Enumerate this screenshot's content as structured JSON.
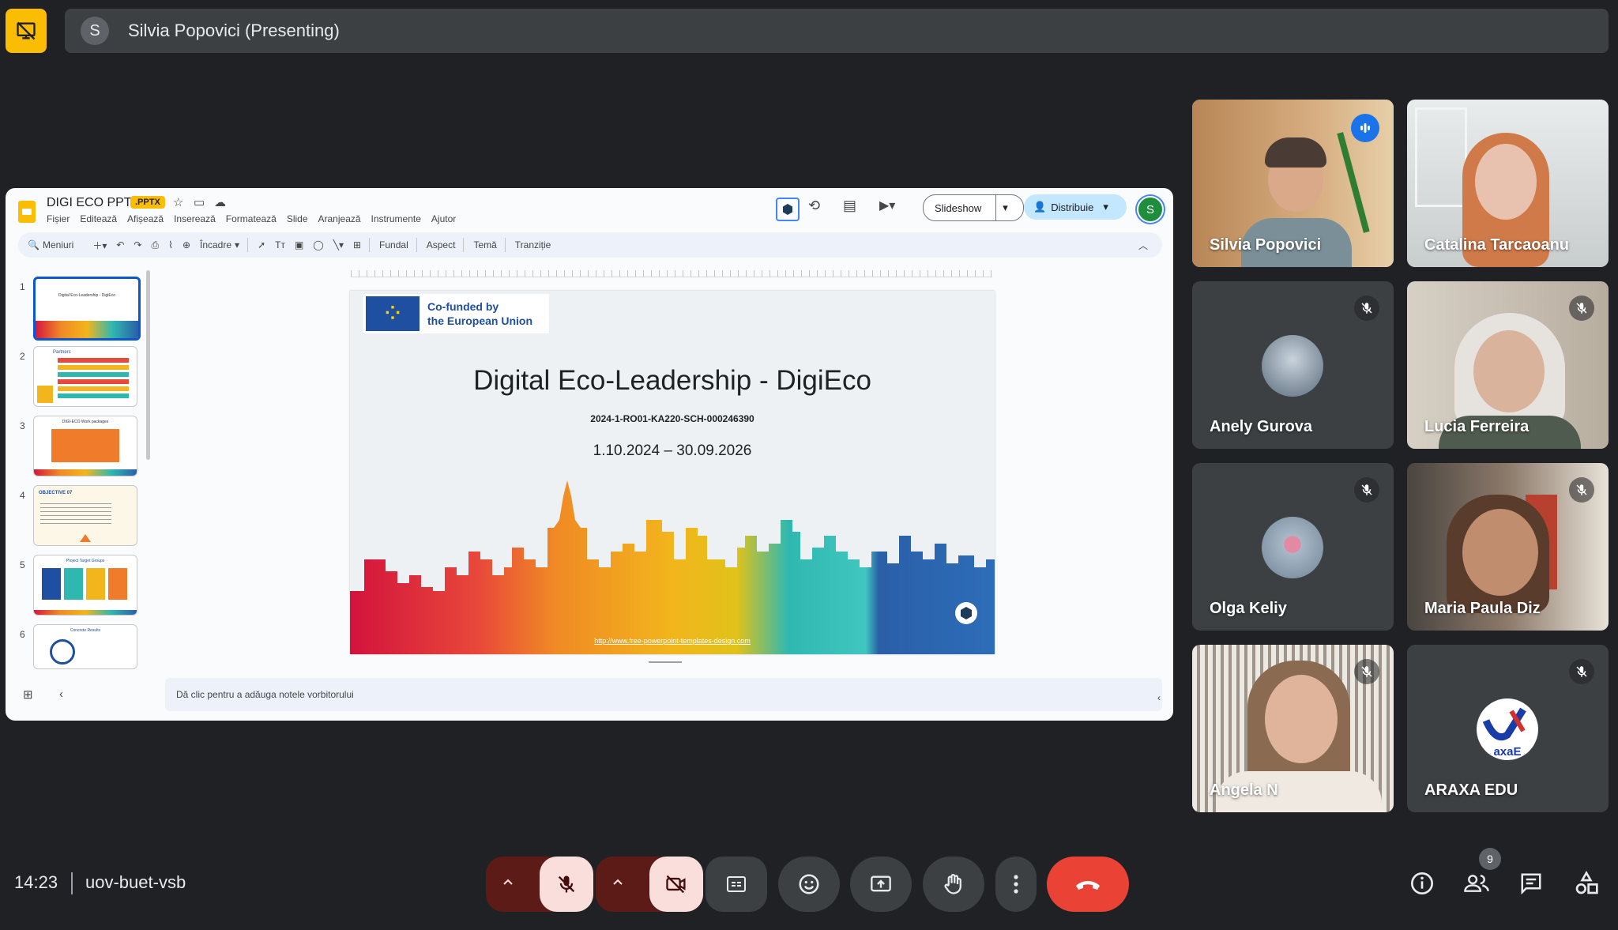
{
  "presenter": {
    "avatar_letter": "S",
    "label": "Silvia Popovici (Presenting)"
  },
  "slides_app": {
    "doc_title": "DIGI ECO PPT",
    "doc_badge": ".PPTX",
    "menu": [
      "Fișier",
      "Editează",
      "Afișează",
      "Inserează",
      "Formatează",
      "Slide",
      "Aranjează",
      "Instrumente",
      "Ajutor"
    ],
    "toolbar": {
      "menus": "Meniuri",
      "fit": "Încadre",
      "background": "Fundal",
      "layout": "Aspect",
      "theme": "Temă",
      "transition": "Tranziție"
    },
    "slideshow_label": "Slideshow",
    "share_label": "Distribuie",
    "user_letter": "S",
    "thumbnails": [
      {
        "num": "1",
        "title": "Digital Eco-Leadership - DigiEco"
      },
      {
        "num": "2",
        "title": "Partners"
      },
      {
        "num": "3",
        "title": "DIGI-ECO Work packages"
      },
      {
        "num": "4",
        "title": "OBJECTIVE 07"
      },
      {
        "num": "5",
        "title": "Project Target Groups"
      },
      {
        "num": "6",
        "title": "Concrete Results"
      }
    ],
    "notes_placeholder": "Dă clic pentru a adăuga notele vorbitorului"
  },
  "slide": {
    "eu_text_1": "Co-funded by",
    "eu_text_2": "the European Union",
    "title": "Digital Eco-Leadership - DigiEco",
    "code": "2024-1-RO01-KA220-SCH-000246390",
    "dates": "1.10.2024 – 30.09.2026",
    "url": "http://www.free-powerpoint-templates-design.com"
  },
  "participants": [
    {
      "name": "Silvia Popovici",
      "speaking": true,
      "muted": false
    },
    {
      "name": "Catalina Tarcaoanu",
      "speaking": false,
      "muted": false
    },
    {
      "name": "Anely Gurova",
      "speaking": false,
      "muted": true
    },
    {
      "name": "Lucia Ferreira",
      "speaking": false,
      "muted": true
    },
    {
      "name": "Olga Keliy",
      "speaking": false,
      "muted": true
    },
    {
      "name": "Maria Paula Diz",
      "speaking": false,
      "muted": true
    },
    {
      "name": "Angela N",
      "speaking": false,
      "muted": true
    },
    {
      "name": "ARAXA EDU",
      "speaking": false,
      "muted": true
    }
  ],
  "araxa_logo_text": "axaE",
  "meeting": {
    "time": "14:23",
    "code": "uov-buet-vsb",
    "people_count": "9"
  },
  "colors": {
    "background": "#202124",
    "hangup": "#ea4335",
    "speaking_border": "#8ab4f8",
    "present_button": "#fbbc04"
  }
}
